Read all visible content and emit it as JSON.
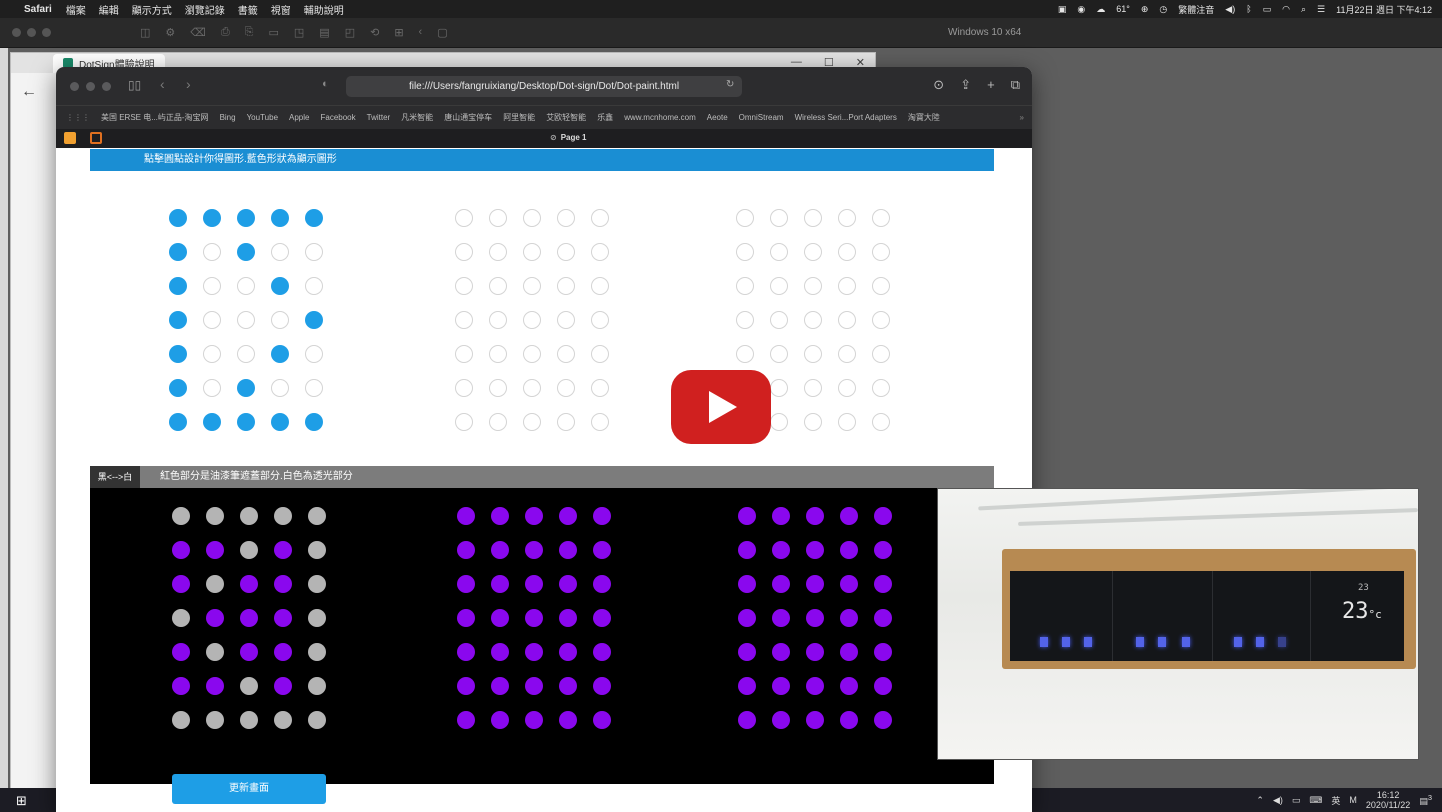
{
  "mac_menubar": {
    "app": "Safari",
    "menus": [
      "檔案",
      "編輯",
      "顯示方式",
      "瀏覽記錄",
      "書籤",
      "視窗",
      "輔助說明"
    ],
    "weather": "61°",
    "input_method": "繁體注音",
    "datetime": "11月22日 週日 下午4:12"
  },
  "vm": {
    "title": "Windows 10 x64"
  },
  "edge": {
    "tab_title": "DotSign體驗說明"
  },
  "safari": {
    "url": "file:///Users/fangruixiang/Desktop/Dot-sign/Dot/Dot-paint.html",
    "bookmarks": [
      "美国 ERSE 电...屿正品-淘宝网",
      "Bing",
      "YouTube",
      "Apple",
      "Facebook",
      "Twitter",
      "凡米智能",
      "唐山通宝停车",
      "阿里智能",
      "艾欧轻智能",
      "乐鑫",
      "www.mcnhome.com",
      "Aeote",
      "OmniStream",
      "Wireless Seri...Port Adapters",
      "淘寶大陸"
    ],
    "tab_title": "Page 1"
  },
  "page": {
    "design_header": "點擊圓點設計你得圖形.藍色形狀為顯示圖形",
    "toggle_label": "黑<-->白",
    "mask_note": "紅色部分是油漆筆遮蓋部分.白色為透光部分",
    "update_button": "更新畫面",
    "design_matrix_1": [
      [
        1,
        1,
        1,
        1,
        1
      ],
      [
        1,
        0,
        1,
        0,
        0
      ],
      [
        1,
        0,
        0,
        1,
        0
      ],
      [
        1,
        0,
        0,
        0,
        1
      ],
      [
        1,
        0,
        0,
        1,
        0
      ],
      [
        1,
        0,
        1,
        0,
        0
      ],
      [
        1,
        1,
        1,
        1,
        1
      ]
    ],
    "mask_matrix_1": [
      [
        0,
        0,
        0,
        0,
        0
      ],
      [
        1,
        1,
        0,
        1,
        0
      ],
      [
        1,
        0,
        1,
        1,
        0
      ],
      [
        0,
        1,
        1,
        1,
        0
      ],
      [
        1,
        0,
        1,
        1,
        0
      ],
      [
        1,
        1,
        0,
        1,
        0
      ],
      [
        0,
        0,
        0,
        0,
        0
      ]
    ]
  },
  "taskbar": {
    "language": "英",
    "time": "16:12",
    "date": "2020/11/22",
    "notification_count": "3"
  },
  "inset_video": {
    "display_temp": "23",
    "unit": "°c",
    "small_temp": "23"
  },
  "colors": {
    "on": "#1e9ee6",
    "mask": "#8a08ee",
    "clear": "#b4b4b4",
    "header_blue": "#1a8ed3",
    "yt_red": "#d0201f"
  }
}
